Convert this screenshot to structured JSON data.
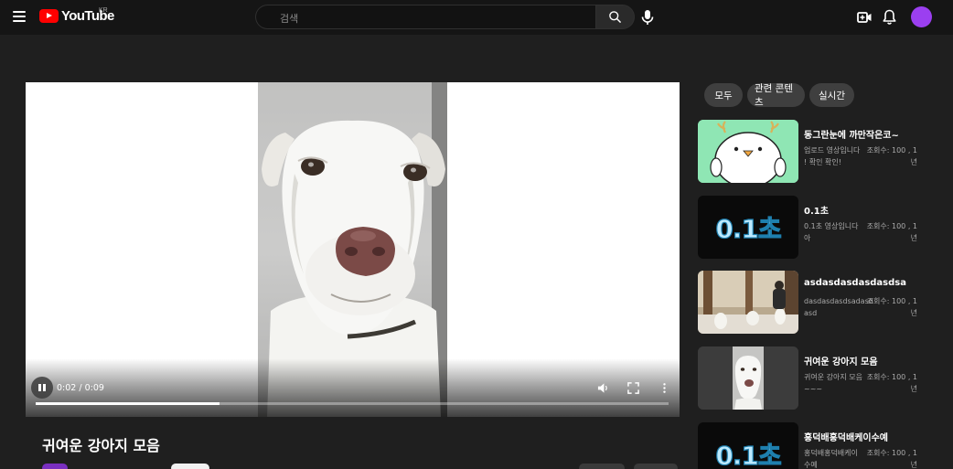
{
  "header": {
    "logo_text": "YouTube",
    "region": "KR",
    "search_placeholder": "검색",
    "icons": [
      "menu-icon",
      "search-icon",
      "mic-icon",
      "create-video-icon",
      "bell-icon",
      "avatar"
    ]
  },
  "player": {
    "time": "0:02 / 0:09",
    "progress": 0.29,
    "controls": [
      "play-pause-icon",
      "volume-icon",
      "fullscreen-icon",
      "more-icon"
    ]
  },
  "video": {
    "title": "귀여운 강아지 모음"
  },
  "chips": [
    "모두",
    "관련 콘텐츠",
    "실시간"
  ],
  "recommendations": [
    {
      "title": "동그란눈에 까만작은코~",
      "desc": "업로드 영상입니다 ! 확인 확인!",
      "views": "조회수: 100 , 1년",
      "thumb": "cartoon-creature"
    },
    {
      "title": "0.1초",
      "desc": "0.1초 영상입니다아",
      "views": "조회수: 100 , 1년",
      "thumb": "text",
      "thumb_text": "0.1초"
    },
    {
      "title": "asdasdasdasdasdsa",
      "desc": "dasdasdasdsadasdasd",
      "views": "조회수: 100 , 1년",
      "thumb": "room-photo"
    },
    {
      "title": "귀여운 강아지 모음",
      "desc": "귀여운 강아지 모음~~~",
      "views": "조회수: 100 , 1년",
      "thumb": "dog-photo"
    },
    {
      "title": "홍덕배홍덕배케이수예",
      "desc": "홍덕배홍덕배케이수예",
      "views": "조회수: 100 , 1년",
      "thumb": "text",
      "thumb_text": "0.1초"
    }
  ],
  "colors": {
    "background": "#1f1f1f",
    "brand": "#ff0000",
    "avatar": "#9b3ff0"
  }
}
